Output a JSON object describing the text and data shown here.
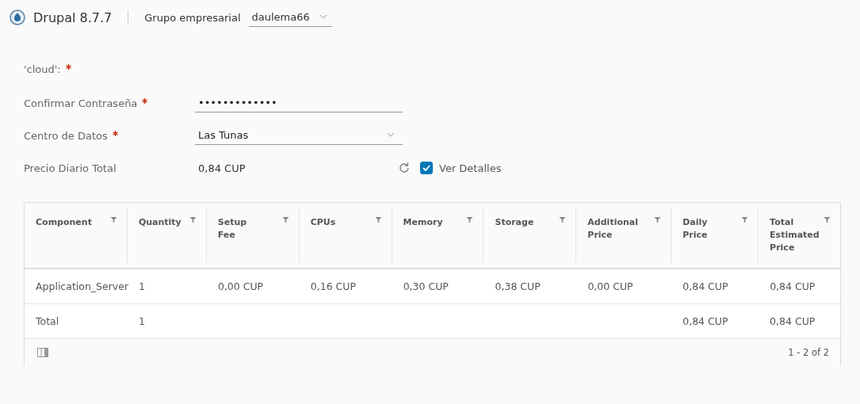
{
  "header": {
    "product": "Drupal 8.7.7",
    "group_label": "Grupo empresarial",
    "group_value": "daulema66"
  },
  "form": {
    "section_label": "'cloud':",
    "section_required": true,
    "fields": [
      {
        "kind": "password",
        "label": "Confirmar Contraseña",
        "required": true,
        "value": "•••••••••••••"
      },
      {
        "kind": "select",
        "label": "Centro de Datos",
        "required": true,
        "value": "Las Tunas"
      },
      {
        "kind": "readout",
        "label": "Precio Diario Total",
        "required": false,
        "value": "0,84 CUP"
      }
    ],
    "details_checkbox": {
      "label": "Ver Detalles",
      "checked": true
    }
  },
  "table": {
    "columns": [
      "Component",
      "Quantity",
      "Setup Fee",
      "CPUs",
      "Memory",
      "Storage",
      "Additional Price",
      "Daily Price",
      "Total Estimated Price"
    ],
    "rows": [
      [
        "Application_Server",
        "1",
        "0,00 CUP",
        "0,16 CUP",
        "0,30 CUP",
        "0,38 CUP",
        "0,00 CUP",
        "0,84 CUP",
        "0,84 CUP"
      ],
      [
        "Total",
        "1",
        null,
        null,
        null,
        null,
        null,
        "0,84 CUP",
        "0,84 CUP"
      ]
    ],
    "pagination": "1 - 2 of 2"
  }
}
